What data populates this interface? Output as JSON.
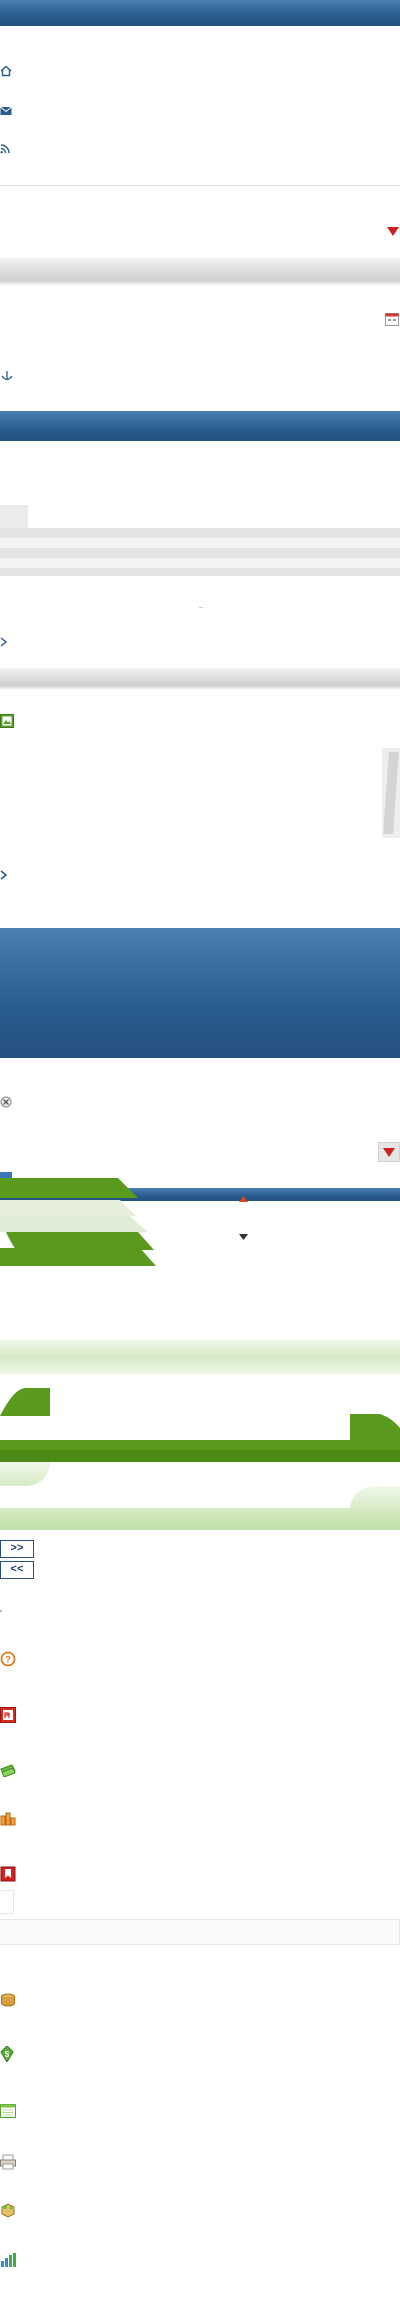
{
  "header": {
    "title": ""
  },
  "nav": {
    "items": [
      {
        "icon": "home-icon"
      },
      {
        "icon": "mail-icon"
      },
      {
        "icon": "rss-icon"
      }
    ]
  },
  "dropdown": {
    "value": ""
  },
  "date_field": {
    "value": ""
  },
  "section_header": {
    "title": ""
  },
  "dialog": {
    "title": ""
  },
  "pager": {
    "next_label": ">>",
    "prev_label": "<<"
  },
  "colors": {
    "primary_blue": "#2a5c8f",
    "accent_green": "#5a9b1e",
    "light_green": "#d6ebc6",
    "alert_red": "#cc2222"
  },
  "app_icons": [
    "help-icon",
    "pdf-icon",
    "money-icon",
    "buildings-icon",
    "bookmark-icon",
    "coins-icon",
    "dollar-icon",
    "calendar-icon",
    "print-icon",
    "package-icon",
    "bar-chart-icon"
  ]
}
